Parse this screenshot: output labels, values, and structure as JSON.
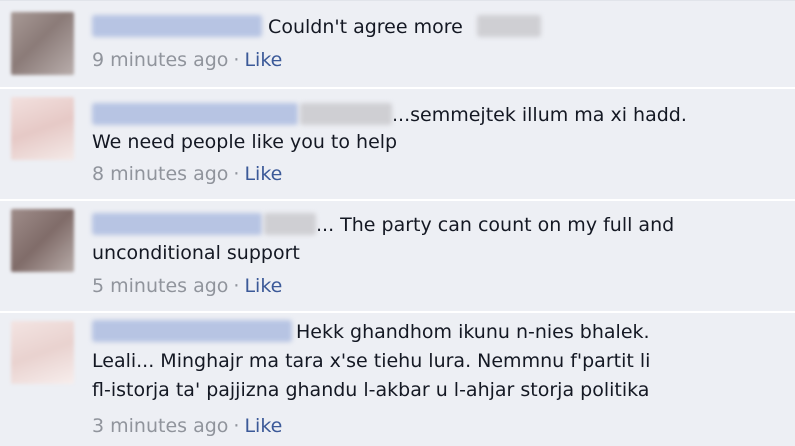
{
  "comments": [
    {
      "lines": [
        "Couldn't agree more"
      ],
      "time": "9 minutes ago",
      "like": "Like"
    },
    {
      "lines": [
        "...semmejtek illum ma xi hadd.",
        "We need people like you to help"
      ],
      "time": "8 minutes ago",
      "like": "Like"
    },
    {
      "lines": [
        "... The party can count on my full and",
        "unconditional support"
      ],
      "time": "5 minutes ago",
      "like": "Like"
    },
    {
      "lines": [
        "Hekk ghandhom ikunu n-nies bhalek.",
        "Leali... Minghajr ma tara x'se tiehu lura. Nemmnu f'partit li",
        "fl-istorja ta' pajjizna ghandu l-akbar u l-ahjar storja politika"
      ],
      "time": "3 minutes ago",
      "like": "Like"
    }
  ],
  "separator": "·",
  "colors": {
    "background": "#edeff4",
    "text": "#141823",
    "meta": "#90949c",
    "link": "#3b5998"
  }
}
